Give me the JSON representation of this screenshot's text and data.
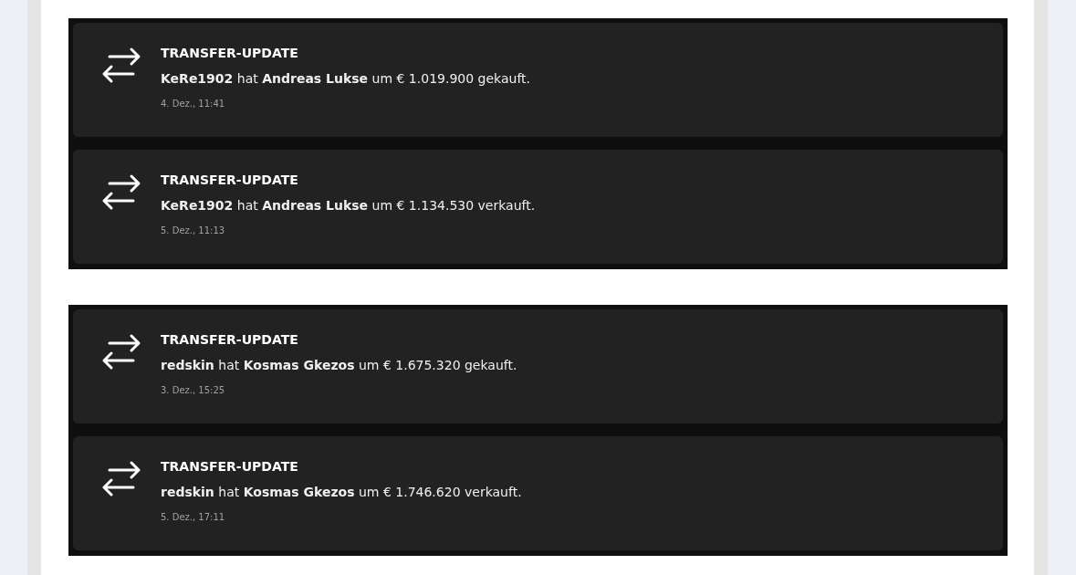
{
  "groups": [
    {
      "notifications": [
        {
          "title": "TRANSFER-UPDATE",
          "message": "**KeRe1902** hat **Andreas Lukse** um € 1.019.900 gekauft.",
          "time": "4. Dez., 11:41"
        },
        {
          "title": "TRANSFER-UPDATE",
          "message": "**KeRe1902** hat **Andreas Lukse** um € 1.134.530 verkauft.",
          "time": "5. Dez., 11:13"
        }
      ]
    },
    {
      "notifications": [
        {
          "title": "TRANSFER-UPDATE",
          "message": "**redskin** hat **Kosmas Gkezos** um € 1.675.320 gekauft.",
          "time": "3. Dez., 15:25"
        },
        {
          "title": "TRANSFER-UPDATE",
          "message": "**redskin** hat **Kosmas Gkezos** um € 1.746.620 verkauft.",
          "time": "5. Dez., 17:11"
        }
      ]
    }
  ]
}
